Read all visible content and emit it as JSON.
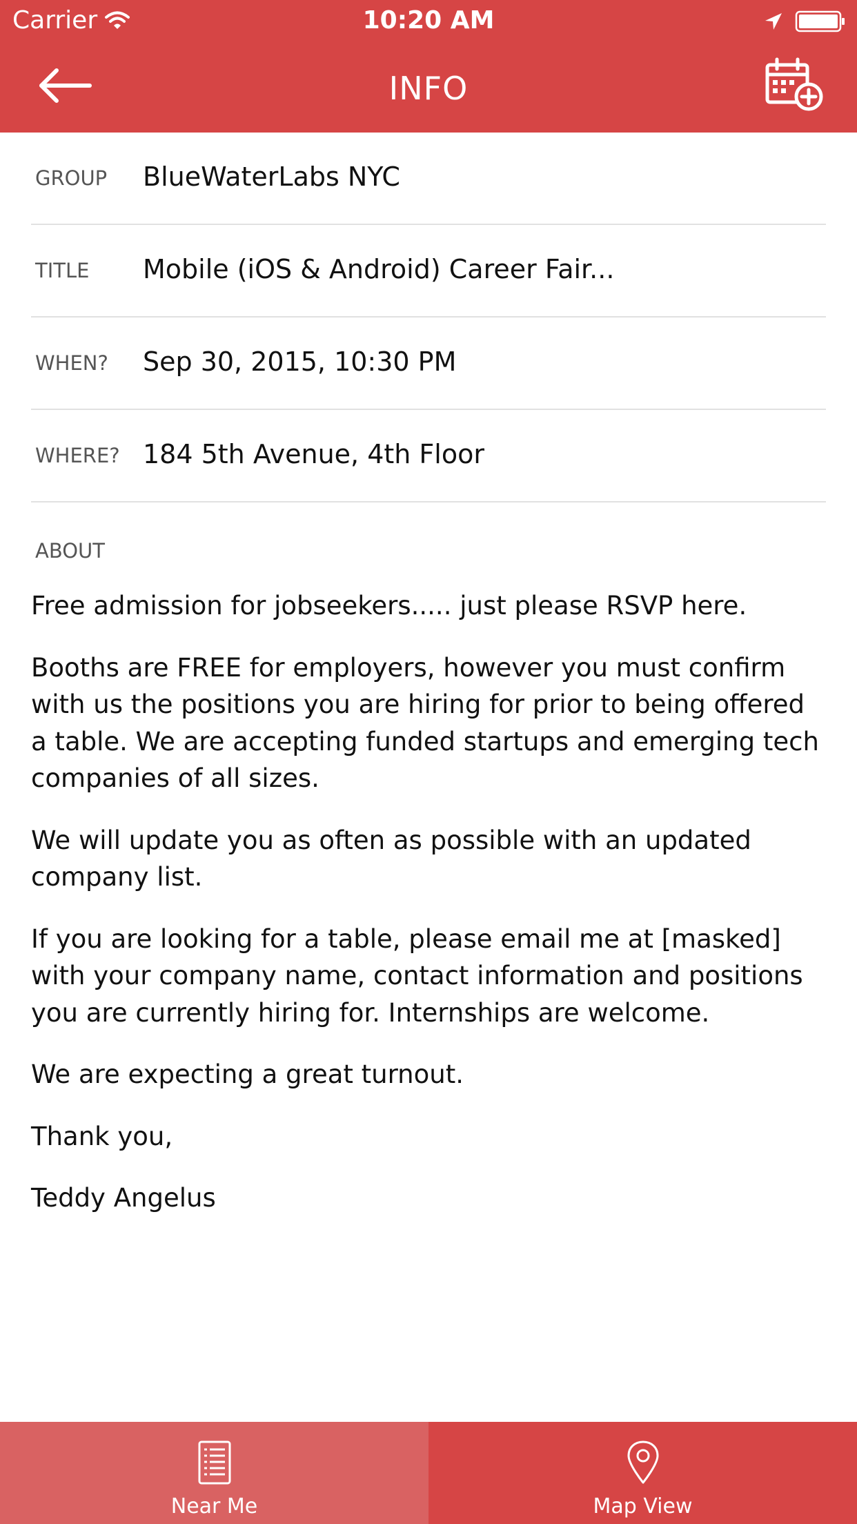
{
  "status_bar": {
    "carrier": "Carrier",
    "time": "10:20 AM"
  },
  "header": {
    "title": "INFO",
    "back_icon": "arrow-left-icon",
    "action_icon": "calendar-add-icon",
    "background_color": "#d64545"
  },
  "info_rows": [
    {
      "label": "GROUP",
      "value": "BlueWaterLabs NYC"
    },
    {
      "label": "TITLE",
      "value": "Mobile (iOS & Android) Career Fair..."
    },
    {
      "label": "WHEN?",
      "value": "Sep 30, 2015, 10:30 PM"
    },
    {
      "label": "WHERE?",
      "value": "184 5th Avenue, 4th Floor"
    }
  ],
  "about": {
    "label": "ABOUT",
    "paragraphs": [
      "Free admission for jobseekers..... just please RSVP here.",
      "Booths are FREE for employers, however you must confirm with us the positions you are hiring for prior to being offered a table. We are accepting funded startups and emerging tech companies of all sizes.",
      "We will update you as often as possible with an updated company list.",
      "If you are looking for a table, please email me at [masked] with your company name, contact information and positions you are currently hiring for. Internships are welcome.",
      "We are expecting a great turnout.",
      "Thank you,",
      "Teddy Angelus"
    ]
  },
  "tabs": [
    {
      "label": "Near Me",
      "icon": "list-document-icon",
      "selected": true
    },
    {
      "label": "Map View",
      "icon": "map-pin-icon",
      "selected": false
    }
  ],
  "colors": {
    "accent": "#d64545",
    "active_tab": "#d96262",
    "divider": "#e1e1e1"
  }
}
